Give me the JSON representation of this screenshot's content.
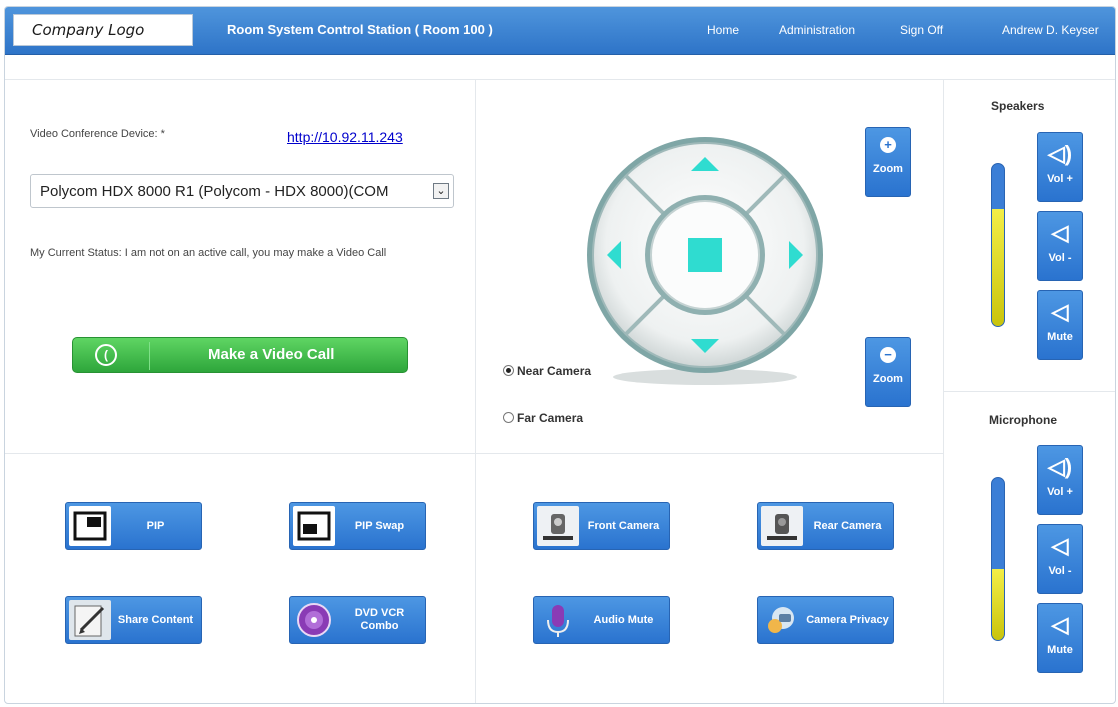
{
  "header": {
    "logo_text": "Company Logo",
    "title": "Room System Control Station ( Room 100 )",
    "nav": [
      "Home",
      "Administration",
      "Sign Off"
    ],
    "user": "Andrew D. Keyser"
  },
  "device": {
    "label": "Video Conference Device: *",
    "link": "http://10.92.11.243",
    "selected": "Polycom HDX 8000 R1 (Polycom - HDX 8000)(COM"
  },
  "status": {
    "text": "My Current Status: I am not on an active call, you may make a Video Call"
  },
  "make_call": {
    "label": "Make a Video Call"
  },
  "camera": {
    "zoom_in_label": "Zoom",
    "zoom_out_label": "Zoom",
    "near_label": "Near Camera",
    "far_label": "Far Camera",
    "selected": "Near Camera"
  },
  "left_buttons": [
    {
      "label": "PIP",
      "icon": "pip-icon"
    },
    {
      "label": "PIP Swap",
      "icon": "pip-swap-icon"
    },
    {
      "label": "Share Content",
      "icon": "share-content-icon"
    },
    {
      "label": "DVD VCR Combo",
      "icon": "dvd-icon"
    }
  ],
  "mid_buttons": [
    {
      "label": "Front Camera",
      "icon": "front-camera-icon"
    },
    {
      "label": "Rear Camera",
      "icon": "rear-camera-icon"
    },
    {
      "label": "Audio Mute",
      "icon": "microphone-icon"
    },
    {
      "label": "Camera Privacy",
      "icon": "camera-privacy-icon"
    }
  ],
  "speakers": {
    "title": "Speakers",
    "vol_up": "Vol +",
    "vol_down": "Vol -",
    "mute": "Mute",
    "level": 0.72
  },
  "microphone": {
    "title": "Microphone",
    "vol_up": "Vol +",
    "vol_down": "Vol -",
    "mute": "Mute",
    "level": 0.44
  },
  "colors": {
    "header": "#3a82d4",
    "accent": "#2a73cf",
    "green": "#2ea63b",
    "teal": "#2fdcd0",
    "slider_fill": "#e6e12a"
  }
}
